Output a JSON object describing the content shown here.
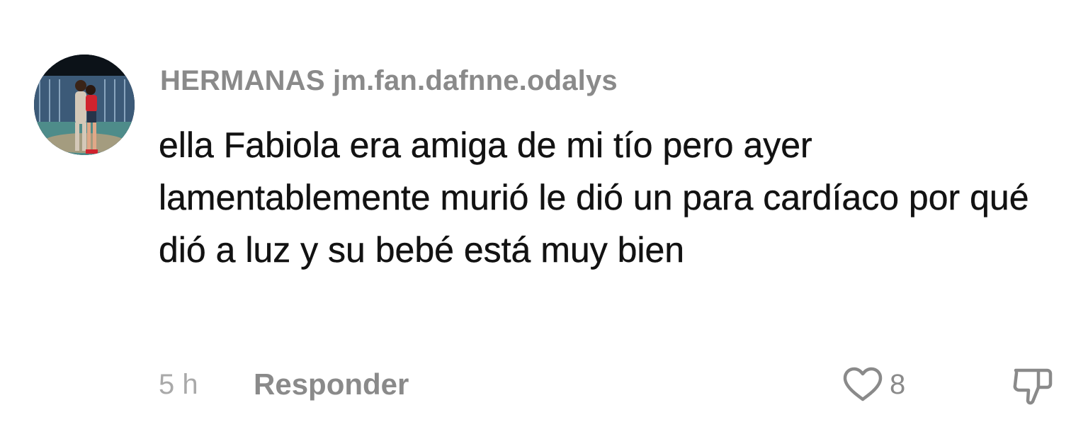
{
  "comment": {
    "username": "HERMANAS jm.fan.dafnne.odalys",
    "text": "ella Fabiola era amiga de mi tío pero ayer lamentablemente murió le dió un para cardíaco por qué dió a luz y su bebé está muy bien",
    "timestamp": "5 h",
    "reply_label": "Responder",
    "like_count": "8"
  },
  "icons": {
    "like": "heart-outline-icon",
    "dislike": "thumbs-down-outline-icon"
  },
  "colors": {
    "username": "#8a8a8a",
    "text": "#121212",
    "timestamp": "#a9a9a9",
    "icon_stroke": "#8a8a8a"
  }
}
